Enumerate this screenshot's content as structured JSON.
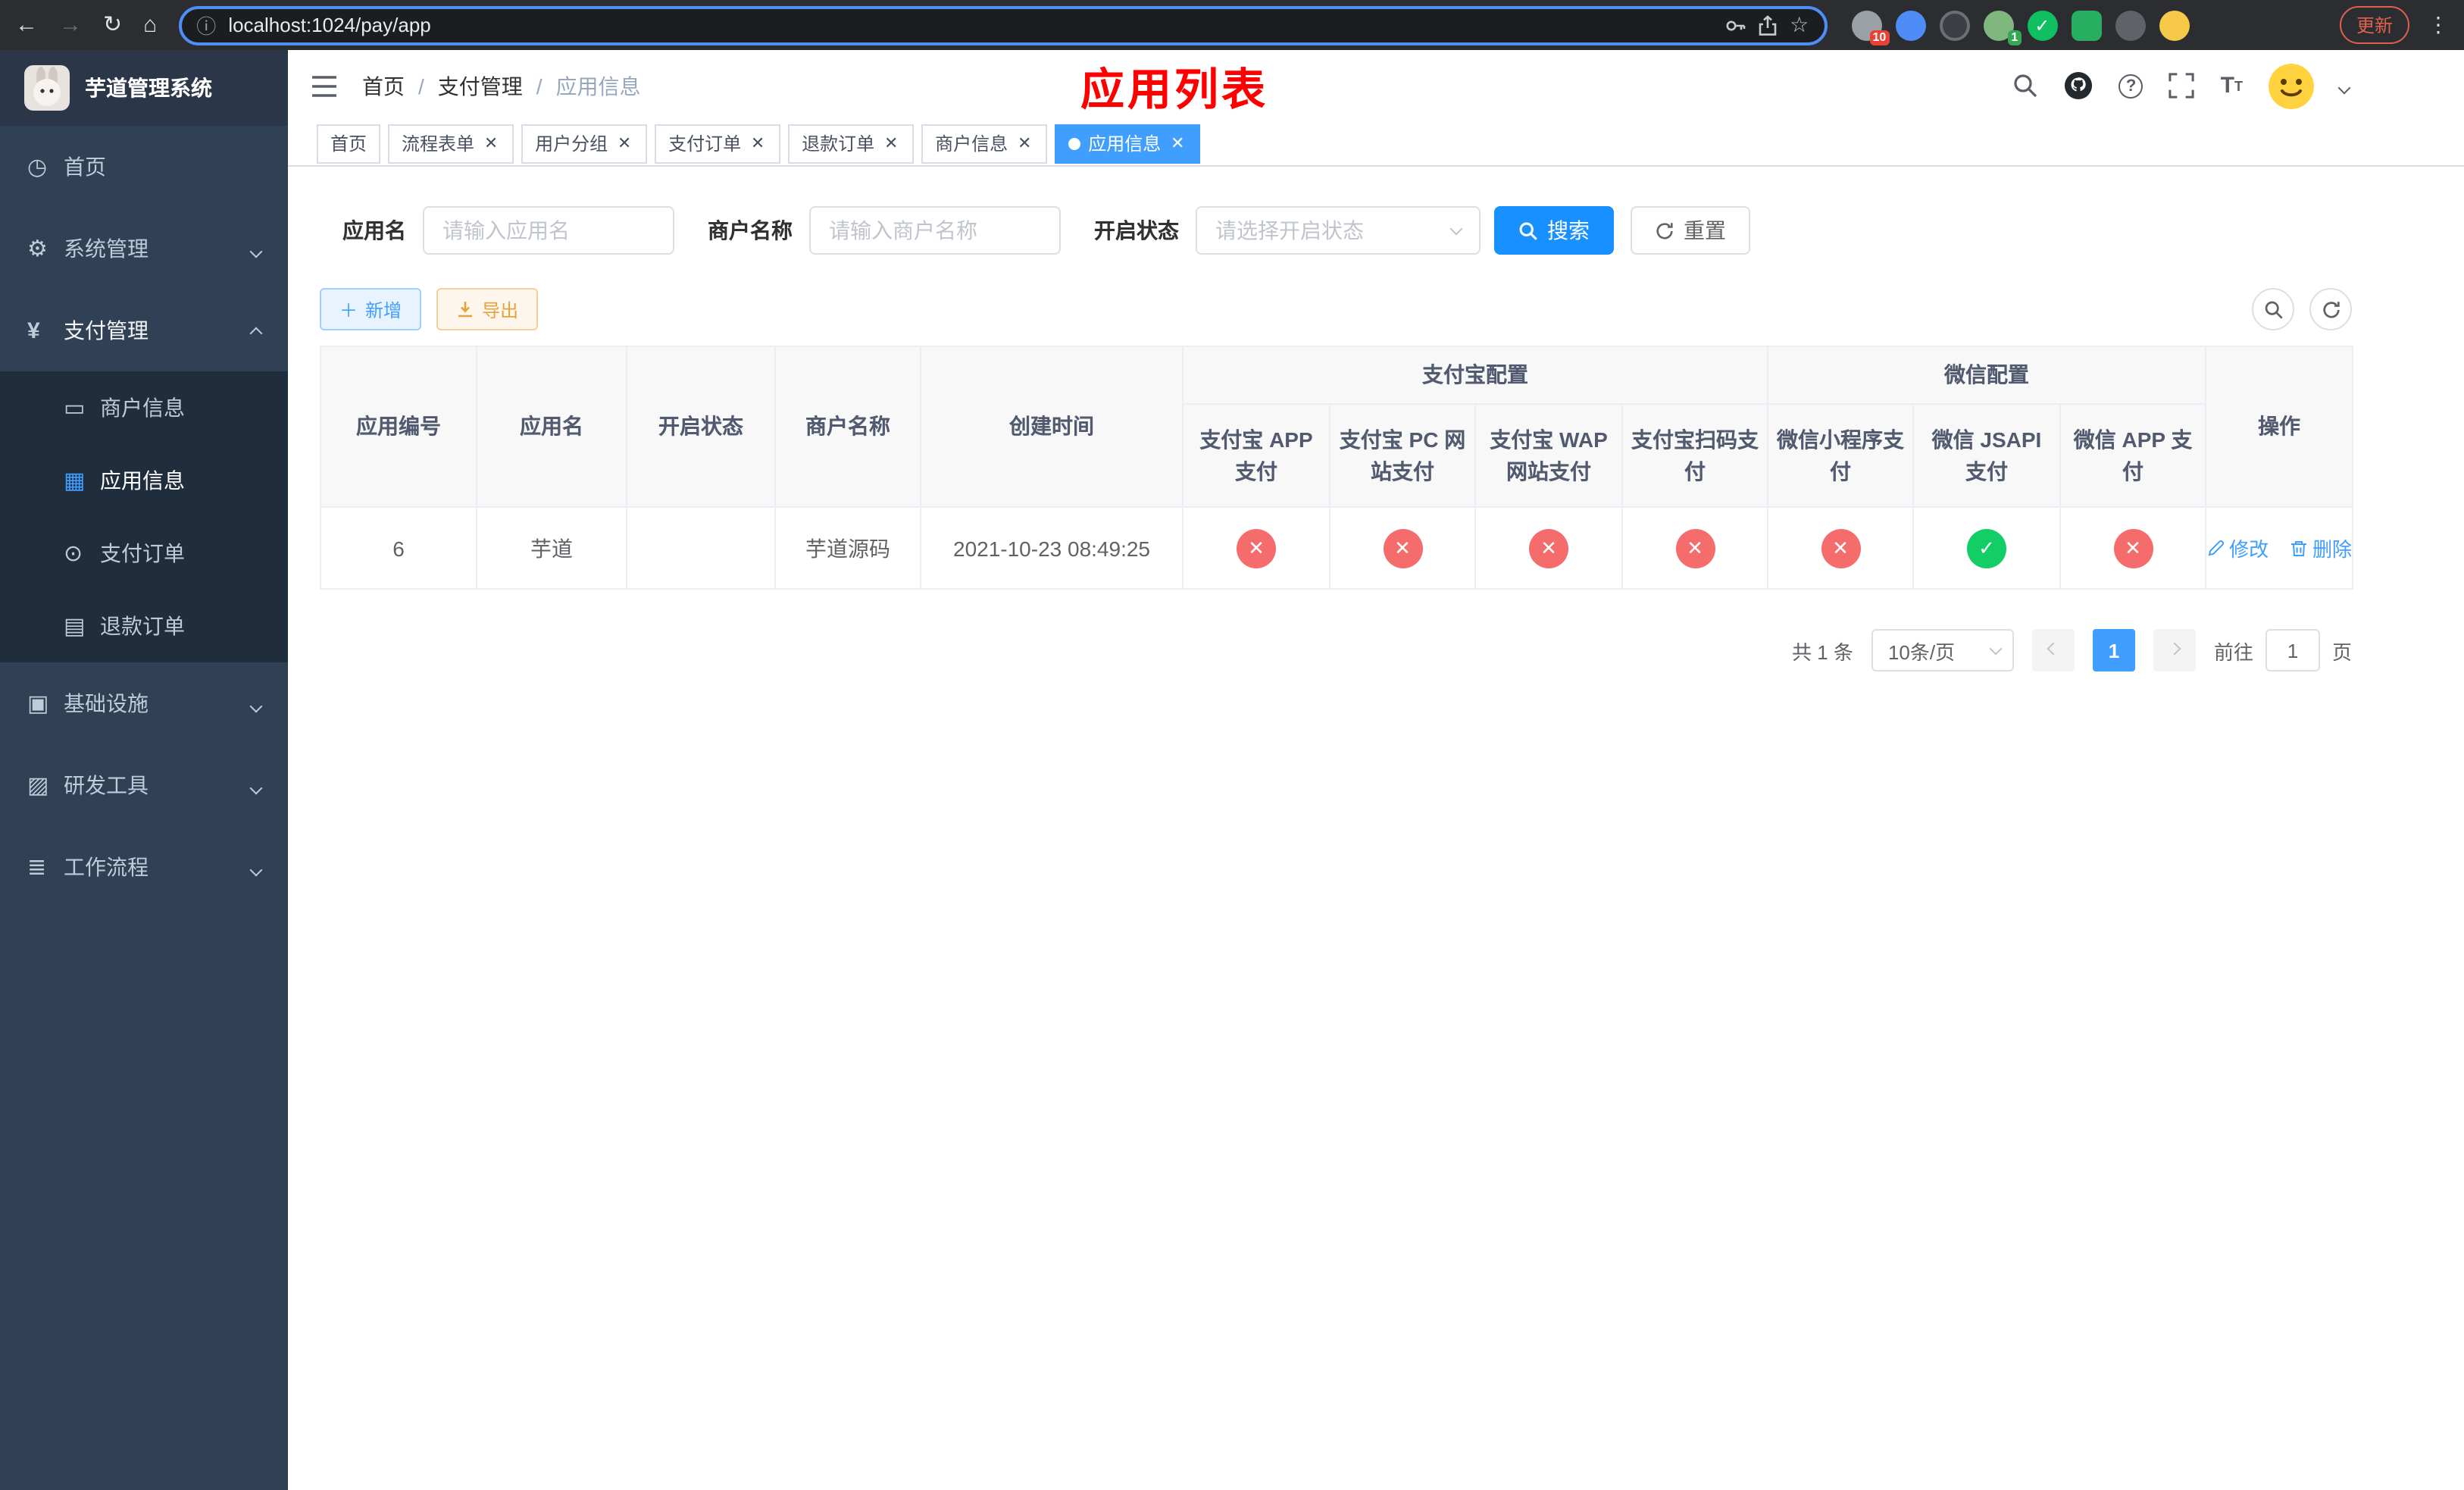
{
  "browser": {
    "url": "localhost:1024/pay/app",
    "update_label": "更新",
    "ext_badge_1": "10",
    "ext_badge_2": "1"
  },
  "sidebar": {
    "app_title": "芋道管理系统",
    "menu_home": "首页",
    "menu_system": "系统管理",
    "menu_pay": "支付管理",
    "menu_infra": "基础设施",
    "menu_dev": "研发工具",
    "menu_flow": "工作流程",
    "sub_merchant": "商户信息",
    "sub_app": "应用信息",
    "sub_order": "支付订单",
    "sub_refund": "退款订单"
  },
  "header": {
    "crumb_1": "首页",
    "crumb_2": "支付管理",
    "crumb_3": "应用信息",
    "page_title": "应用列表"
  },
  "tabs": [
    {
      "label": "首页"
    },
    {
      "label": "流程表单"
    },
    {
      "label": "用户分组"
    },
    {
      "label": "支付订单"
    },
    {
      "label": "退款订单"
    },
    {
      "label": "商户信息"
    },
    {
      "label": "应用信息"
    }
  ],
  "filter": {
    "app_name_label": "应用名",
    "app_name_placeholder": "请输入应用名",
    "merchant_label": "商户名称",
    "merchant_placeholder": "请输入商户名称",
    "status_label": "开启状态",
    "status_placeholder": "请选择开启状态",
    "search_label": "搜索",
    "reset_label": "重置"
  },
  "toolbar": {
    "add_label": "新增",
    "export_label": "导出"
  },
  "table": {
    "headers": {
      "app_id": "应用编号",
      "app_name": "应用名",
      "status": "开启状态",
      "merchant": "商户名称",
      "created": "创建时间",
      "alipay_group": "支付宝配置",
      "wechat_group": "微信配置",
      "alipay_app": "支付宝 APP 支付",
      "alipay_pc": "支付宝 PC 网站支付",
      "alipay_wap": "支付宝 WAP 网站支付",
      "alipay_scan": "支付宝扫码支付",
      "wechat_mini": "微信小程序支付",
      "wechat_jsapi": "微信 JSAPI 支付",
      "wechat_app": "微信 APP 支付",
      "actions": "操作"
    },
    "rows": [
      {
        "app_id": "6",
        "app_name": "芋道",
        "status_on": true,
        "merchant": "芋道源码",
        "created": "2021-10-23 08:49:25",
        "configs": [
          false,
          false,
          false,
          false,
          false,
          true,
          false
        ],
        "edit_label": "修改",
        "delete_label": "删除"
      }
    ]
  },
  "pagination": {
    "total": "共 1 条",
    "page_size": "10条/页",
    "current_page": "1",
    "goto_label": "前往",
    "goto_value": "1",
    "page_unit": "页"
  },
  "colors": {
    "accent": "#409eff",
    "search_button": "#1890ff",
    "success": "#13ce66",
    "danger": "#f56c6c",
    "title": "#ff0000"
  }
}
